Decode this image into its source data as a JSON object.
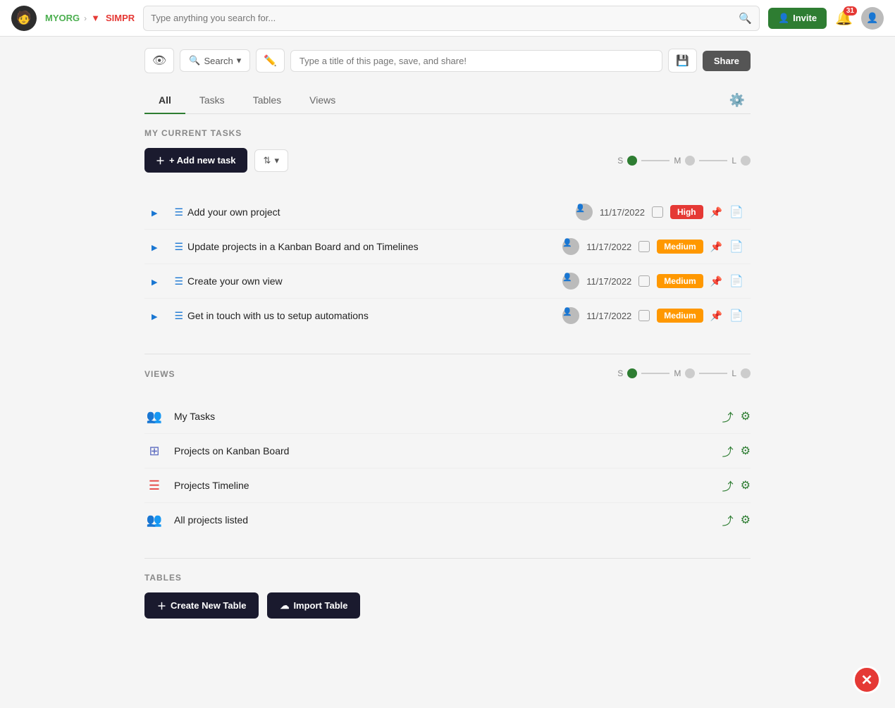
{
  "topNav": {
    "orgName": "MYORG",
    "projName": "SIMPR",
    "searchPlaceholder": "Type anything you search for...",
    "inviteLabel": "Invite",
    "notifCount": "31"
  },
  "toolbar": {
    "searchLabel": "Search",
    "searchDropIcon": "▾",
    "titlePlaceholder": "Type a title of this page, save, and share!",
    "shareLabel": "Share"
  },
  "tabs": {
    "items": [
      {
        "label": "All",
        "active": true
      },
      {
        "label": "Tasks",
        "active": false
      },
      {
        "label": "Tables",
        "active": false
      },
      {
        "label": "Views",
        "active": false
      }
    ]
  },
  "myCurrentTasks": {
    "sectionTitle": "MY CURRENT TASKS",
    "addTaskLabel": "+ Add new task",
    "sizeLabels": {
      "s": "S",
      "m": "M",
      "l": "L"
    },
    "tasks": [
      {
        "name": "Add your own project",
        "date": "11/17/2022",
        "priority": "High",
        "priorityClass": "high"
      },
      {
        "name": "Update projects in a Kanban Board and on Timelines",
        "date": "11/17/2022",
        "priority": "Medium",
        "priorityClass": "medium"
      },
      {
        "name": "Create your own view",
        "date": "11/17/2022",
        "priority": "Medium",
        "priorityClass": "medium"
      },
      {
        "name": "Get in touch with us to setup automations",
        "date": "11/17/2022",
        "priority": "Medium",
        "priorityClass": "medium"
      }
    ]
  },
  "views": {
    "sectionTitle": "VIEWS",
    "sizeLabels": {
      "s": "S",
      "m": "M",
      "l": "L"
    },
    "items": [
      {
        "name": "My Tasks",
        "iconType": "list-person"
      },
      {
        "name": "Projects on Kanban Board",
        "iconType": "kanban"
      },
      {
        "name": "Projects Timeline",
        "iconType": "timeline"
      },
      {
        "name": "All projects listed",
        "iconType": "list-person"
      }
    ]
  },
  "tables": {
    "sectionTitle": "TABLES",
    "createLabel": "Create New Table",
    "importLabel": "Import Table"
  }
}
